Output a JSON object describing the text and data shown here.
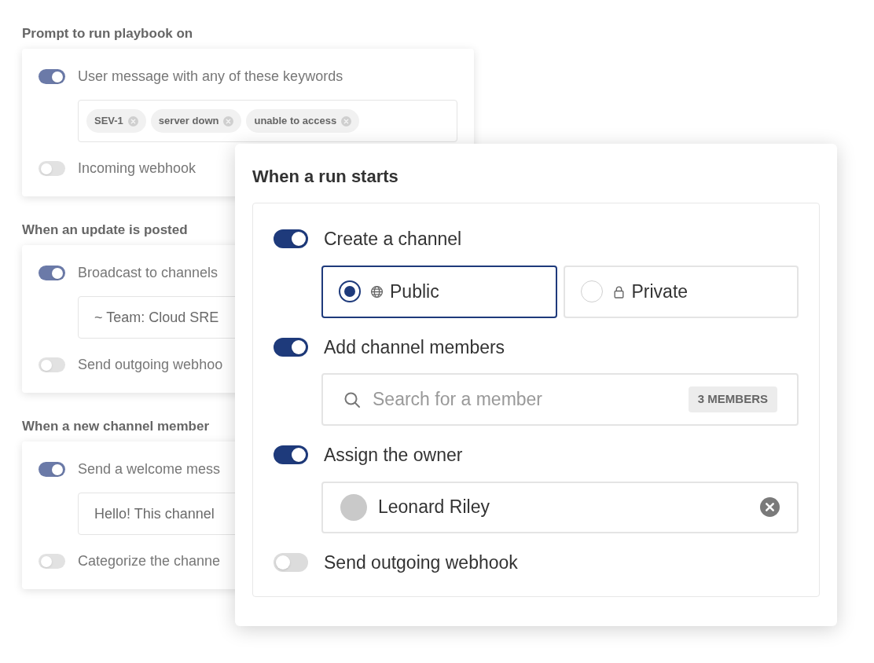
{
  "sections": [
    {
      "heading": "Prompt to run playbook on",
      "rows": [
        {
          "label": "User message with any of these keywords",
          "on": true,
          "field": {
            "kind": "tags",
            "tags": [
              "SEV-1",
              "server down",
              "unable to access"
            ]
          }
        },
        {
          "label": "Incoming webhook",
          "on": false
        }
      ]
    },
    {
      "heading": "When an update is posted",
      "rows": [
        {
          "label": "Broadcast to channels",
          "on": true,
          "field": {
            "kind": "text",
            "value": "~ Team: Cloud SRE"
          }
        },
        {
          "label": "Send outgoing webhoo",
          "on": false
        }
      ]
    },
    {
      "heading": "When a new channel member",
      "rows": [
        {
          "label": "Send a welcome mess",
          "on": true,
          "field": {
            "kind": "text",
            "value": "Hello! This channel"
          }
        },
        {
          "label": "Categorize the channe",
          "on": false
        }
      ]
    }
  ],
  "dialog": {
    "title": "When a run starts",
    "rows": [
      {
        "label": "Create a channel",
        "on": true,
        "field": {
          "kind": "radio",
          "options": [
            {
              "label": "Public",
              "kind": "public",
              "selected": true
            },
            {
              "label": "Private",
              "kind": "private",
              "selected": false
            }
          ]
        }
      },
      {
        "label": "Add channel members",
        "on": true,
        "field": {
          "kind": "search",
          "placeholder": "Search for a member",
          "badge": "3 MEMBERS"
        }
      },
      {
        "label": "Assign the owner",
        "on": true,
        "field": {
          "kind": "person",
          "value": "Leonard Riley"
        }
      },
      {
        "label": "Send outgoing webhook",
        "on": false
      }
    ]
  }
}
